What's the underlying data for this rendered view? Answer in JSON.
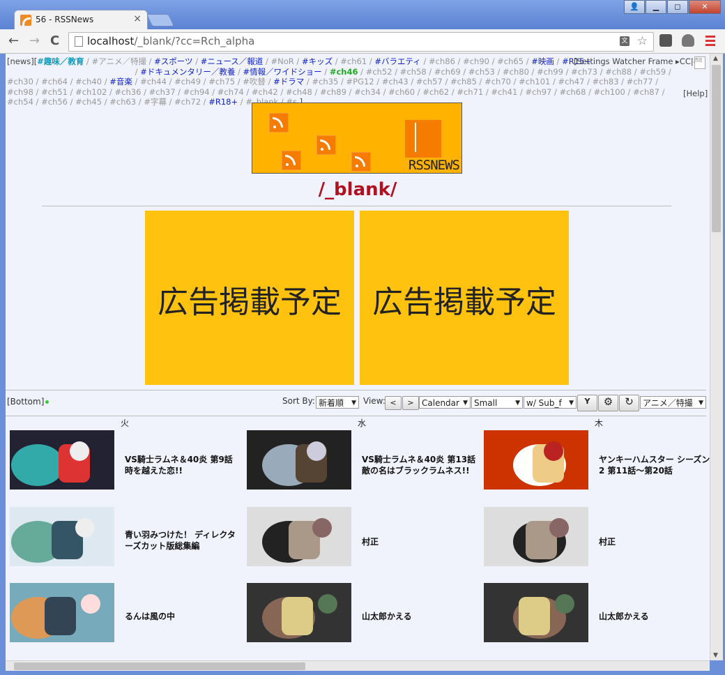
{
  "tab": {
    "title": "56 - RSSNews"
  },
  "window_buttons": [
    "👤",
    "▁",
    "◻",
    "✕"
  ],
  "address": {
    "host": "localhost",
    "path": "/_blank/?cc=Rch_alpha"
  },
  "nav": {
    "back": "←",
    "forward": "→",
    "reload": "C"
  },
  "categories": {
    "prefix": "[news][",
    "items": [
      {
        "label": "#趣味／教育",
        "style": "cyan"
      },
      {
        "label": "#アニメ／特撮",
        "style": "gray"
      },
      {
        "label": "#スポーツ",
        "style": "hot"
      },
      {
        "label": "#ニュース／報道",
        "style": "hot"
      },
      {
        "label": "#NoR",
        "style": "gray"
      },
      {
        "label": "#キッズ",
        "style": "hot"
      },
      {
        "label": "#ch61",
        "style": "gray"
      },
      {
        "label": "#バラエティ",
        "style": "hot"
      },
      {
        "label": "#ch86",
        "style": "gray"
      },
      {
        "label": "#ch90",
        "style": "gray"
      },
      {
        "label": "#ch65",
        "style": "gray"
      },
      {
        "label": "#映画",
        "style": "hot"
      },
      {
        "label": "#R15+",
        "style": "hot"
      },
      {
        "label": "#ドキュメンタリー／教養",
        "style": "hot"
      },
      {
        "label": "#情報／ワイドショー",
        "style": "hot"
      },
      {
        "label": "#ch46",
        "style": "green"
      },
      {
        "label": "#ch52",
        "style": "gray"
      },
      {
        "label": "#ch58",
        "style": "gray"
      },
      {
        "label": "#ch69",
        "style": "gray"
      },
      {
        "label": "#ch53",
        "style": "gray"
      },
      {
        "label": "#ch80",
        "style": "gray"
      },
      {
        "label": "#ch99",
        "style": "gray"
      },
      {
        "label": "#ch73",
        "style": "gray"
      },
      {
        "label": "#ch88",
        "style": "gray"
      },
      {
        "label": "#ch59",
        "style": "gray"
      },
      {
        "label": "#ch30",
        "style": "gray"
      },
      {
        "label": "#ch64",
        "style": "gray"
      },
      {
        "label": "#ch40",
        "style": "gray"
      },
      {
        "label": "#音楽",
        "style": "hot"
      },
      {
        "label": "#ch44",
        "style": "gray"
      },
      {
        "label": "#ch49",
        "style": "gray"
      },
      {
        "label": "#ch75",
        "style": "gray"
      },
      {
        "label": "#吹替",
        "style": "gray"
      },
      {
        "label": "#ドラマ",
        "style": "hot"
      },
      {
        "label": "#ch35",
        "style": "gray"
      },
      {
        "label": "#PG12",
        "style": "gray"
      },
      {
        "label": "#ch43",
        "style": "gray"
      },
      {
        "label": "#ch57",
        "style": "gray"
      },
      {
        "label": "#ch85",
        "style": "gray"
      },
      {
        "label": "#ch70",
        "style": "gray"
      },
      {
        "label": "#ch101",
        "style": "gray"
      },
      {
        "label": "#ch47",
        "style": "gray"
      },
      {
        "label": "#ch83",
        "style": "gray"
      },
      {
        "label": "#ch77",
        "style": "gray"
      },
      {
        "label": "#ch98",
        "style": "gray"
      },
      {
        "label": "#ch51",
        "style": "gray"
      },
      {
        "label": "#ch102",
        "style": "gray"
      },
      {
        "label": "#ch36",
        "style": "gray"
      },
      {
        "label": "#ch37",
        "style": "gray"
      },
      {
        "label": "#ch94",
        "style": "gray"
      },
      {
        "label": "#ch74",
        "style": "gray"
      },
      {
        "label": "#ch42",
        "style": "gray"
      },
      {
        "label": "#ch48",
        "style": "gray"
      },
      {
        "label": "#ch89",
        "style": "gray"
      },
      {
        "label": "#ch34",
        "style": "gray"
      },
      {
        "label": "#ch60",
        "style": "gray"
      },
      {
        "label": "#ch62",
        "style": "gray"
      },
      {
        "label": "#ch71",
        "style": "gray"
      },
      {
        "label": "#ch41",
        "style": "gray"
      },
      {
        "label": "#ch97",
        "style": "gray"
      },
      {
        "label": "#ch68",
        "style": "gray"
      },
      {
        "label": "#ch100",
        "style": "gray"
      },
      {
        "label": "#ch87",
        "style": "gray"
      },
      {
        "label": "#ch54",
        "style": "gray"
      },
      {
        "label": "#ch56",
        "style": "gray"
      },
      {
        "label": "#ch45",
        "style": "gray"
      },
      {
        "label": "#ch63",
        "style": "gray"
      },
      {
        "label": "#字幕",
        "style": "gray"
      },
      {
        "label": "#ch72",
        "style": "gray"
      },
      {
        "label": "#R18+",
        "style": "hot"
      },
      {
        "label": "#_blank",
        "style": "gray"
      },
      {
        "label": "#s",
        "style": "gray"
      }
    ],
    "suffix": "]"
  },
  "settings_text": "[Settings Watcher Frame ▸CC|◂",
  "filter_placeholder": "filt",
  "help_text": "[Help]",
  "logo": {
    "brand": "RSSNEWS"
  },
  "channel_title": "/_blank/",
  "ads": [
    {
      "text": "広告掲載予定"
    },
    {
      "text": "広告掲載予定"
    }
  ],
  "controls": {
    "bottom_link": "[Bottom]",
    "sort_label": "Sort By:",
    "sort_value": "新着順",
    "view_label": "View:",
    "prev": "<",
    "next": ">",
    "view_mode": "Calendar",
    "size": "Small",
    "sub": "w/ Sub_f",
    "filter_icon": "Y",
    "gear_icon": "⚙",
    "refresh_icon": "↻",
    "category": "アニメ／特撮"
  },
  "days": [
    "火",
    "水",
    "木"
  ],
  "cards": [
    [
      {
        "title": "VS騎士ラムネ＆40炎 第9話 時を越えた恋!!",
        "palette": [
          "#223",
          "#3aa",
          "#d33",
          "#eee"
        ]
      },
      {
        "title": "青い羽みつけた！ ディレクターズカット版総集編",
        "palette": [
          "#dde8f0",
          "#6a9",
          "#356",
          "#eee"
        ]
      },
      {
        "title": "るんは風の中",
        "palette": [
          "#7ab",
          "#d95",
          "#345",
          "#fdd"
        ]
      }
    ],
    [
      {
        "title": "VS騎士ラムネ＆40炎 第13話 敵の名はブラックラムネス!!",
        "palette": [
          "#222",
          "#9ab",
          "#543",
          "#ccd"
        ]
      },
      {
        "title": "村正",
        "palette": [
          "#ddd",
          "#222",
          "#a98",
          "#866"
        ]
      },
      {
        "title": "山太郎かえる",
        "palette": [
          "#333",
          "#865",
          "#dc8",
          "#575"
        ]
      }
    ],
    [
      {
        "title": "ヤンキーハムスター シーズン2 第11話〜第20話",
        "palette": [
          "#c30",
          "#fff",
          "#ec8",
          "#b22"
        ]
      },
      {
        "title": "村正",
        "palette": [
          "#ddd",
          "#222",
          "#a98",
          "#866"
        ]
      },
      {
        "title": "山太郎かえる",
        "palette": [
          "#333",
          "#865",
          "#dc8",
          "#575"
        ]
      }
    ]
  ]
}
